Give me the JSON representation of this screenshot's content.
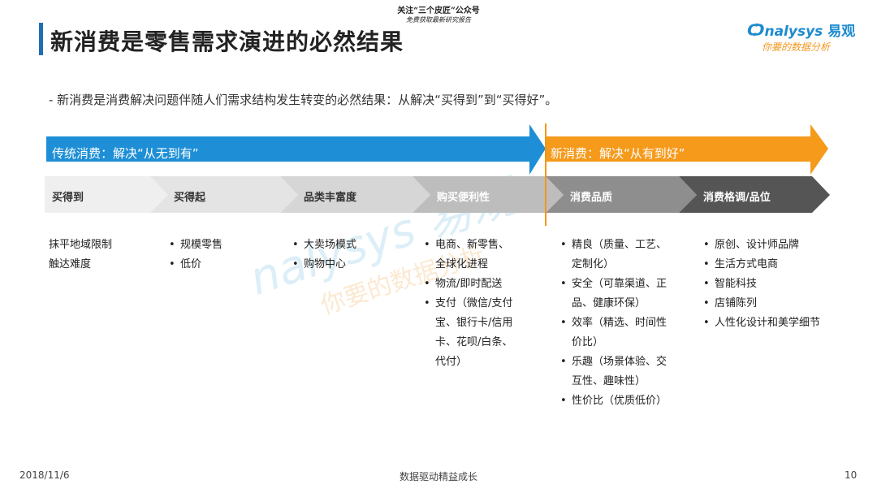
{
  "header": {
    "title": "新消费是零售需求演进的必然结果",
    "top_note_line1": "关注“三个皮匠”公众号",
    "top_note_line2": "免费获取最新研究报告",
    "brand_name": "nalysys",
    "brand_cn": "易观",
    "brand_slogan": "你要的数据分析"
  },
  "subtitle": "-  新消费是消费解决问题伴随人们需求结构发生转变的必然结果：从解决“买得到”到“买得好”。",
  "phases": {
    "traditional": "传统消费：解决“从无到有”",
    "new": "新消费：解决“从有到好”"
  },
  "stages": [
    {
      "label": "买得到"
    },
    {
      "label": "买得起"
    },
    {
      "label": "品类丰富度"
    },
    {
      "label": "购买便利性"
    },
    {
      "label": "消费品质"
    },
    {
      "label": "消费格调/品位"
    }
  ],
  "columns": [
    {
      "items": [
        "抹平地域限制",
        "触达难度"
      ],
      "bullet": false
    },
    {
      "items": [
        "规模零售",
        "低价"
      ],
      "bullet": true
    },
    {
      "items": [
        "大卖场模式",
        "购物中心"
      ],
      "bullet": true
    },
    {
      "items": [
        "电商、新零售、全球化进程",
        "物流/即时配送",
        "支付（微信/支付宝、银行卡/信用卡、花呗/白条、代付）"
      ],
      "bullet": true
    },
    {
      "items": [
        "精良（质量、工艺、定制化）",
        "安全（可靠渠道、正品、健康环保）",
        "效率（精选、时间性价比）",
        "乐趣（场景体验、交互性、趣味性）",
        "性价比（优质低价）"
      ],
      "bullet": true
    },
    {
      "items": [
        "原创、设计师品牌",
        "生活方式电商",
        "智能科技",
        "店铺陈列",
        "人性化设计和美学细节"
      ],
      "bullet": true
    }
  ],
  "watermark": {
    "text1": "nalysys 易观",
    "text2": "你要的数据分析"
  },
  "footer": {
    "date": "2018/11/6",
    "center": "数据驱动精益成长",
    "page": "10"
  },
  "colors": {
    "blue": "#1e8fd6",
    "orange": "#f59a1b",
    "chevron_light": "#efefef",
    "chevron_mid": "#d6d6d6",
    "chevron_gray": "#9a9a9a",
    "chevron_dark": "#555555"
  }
}
